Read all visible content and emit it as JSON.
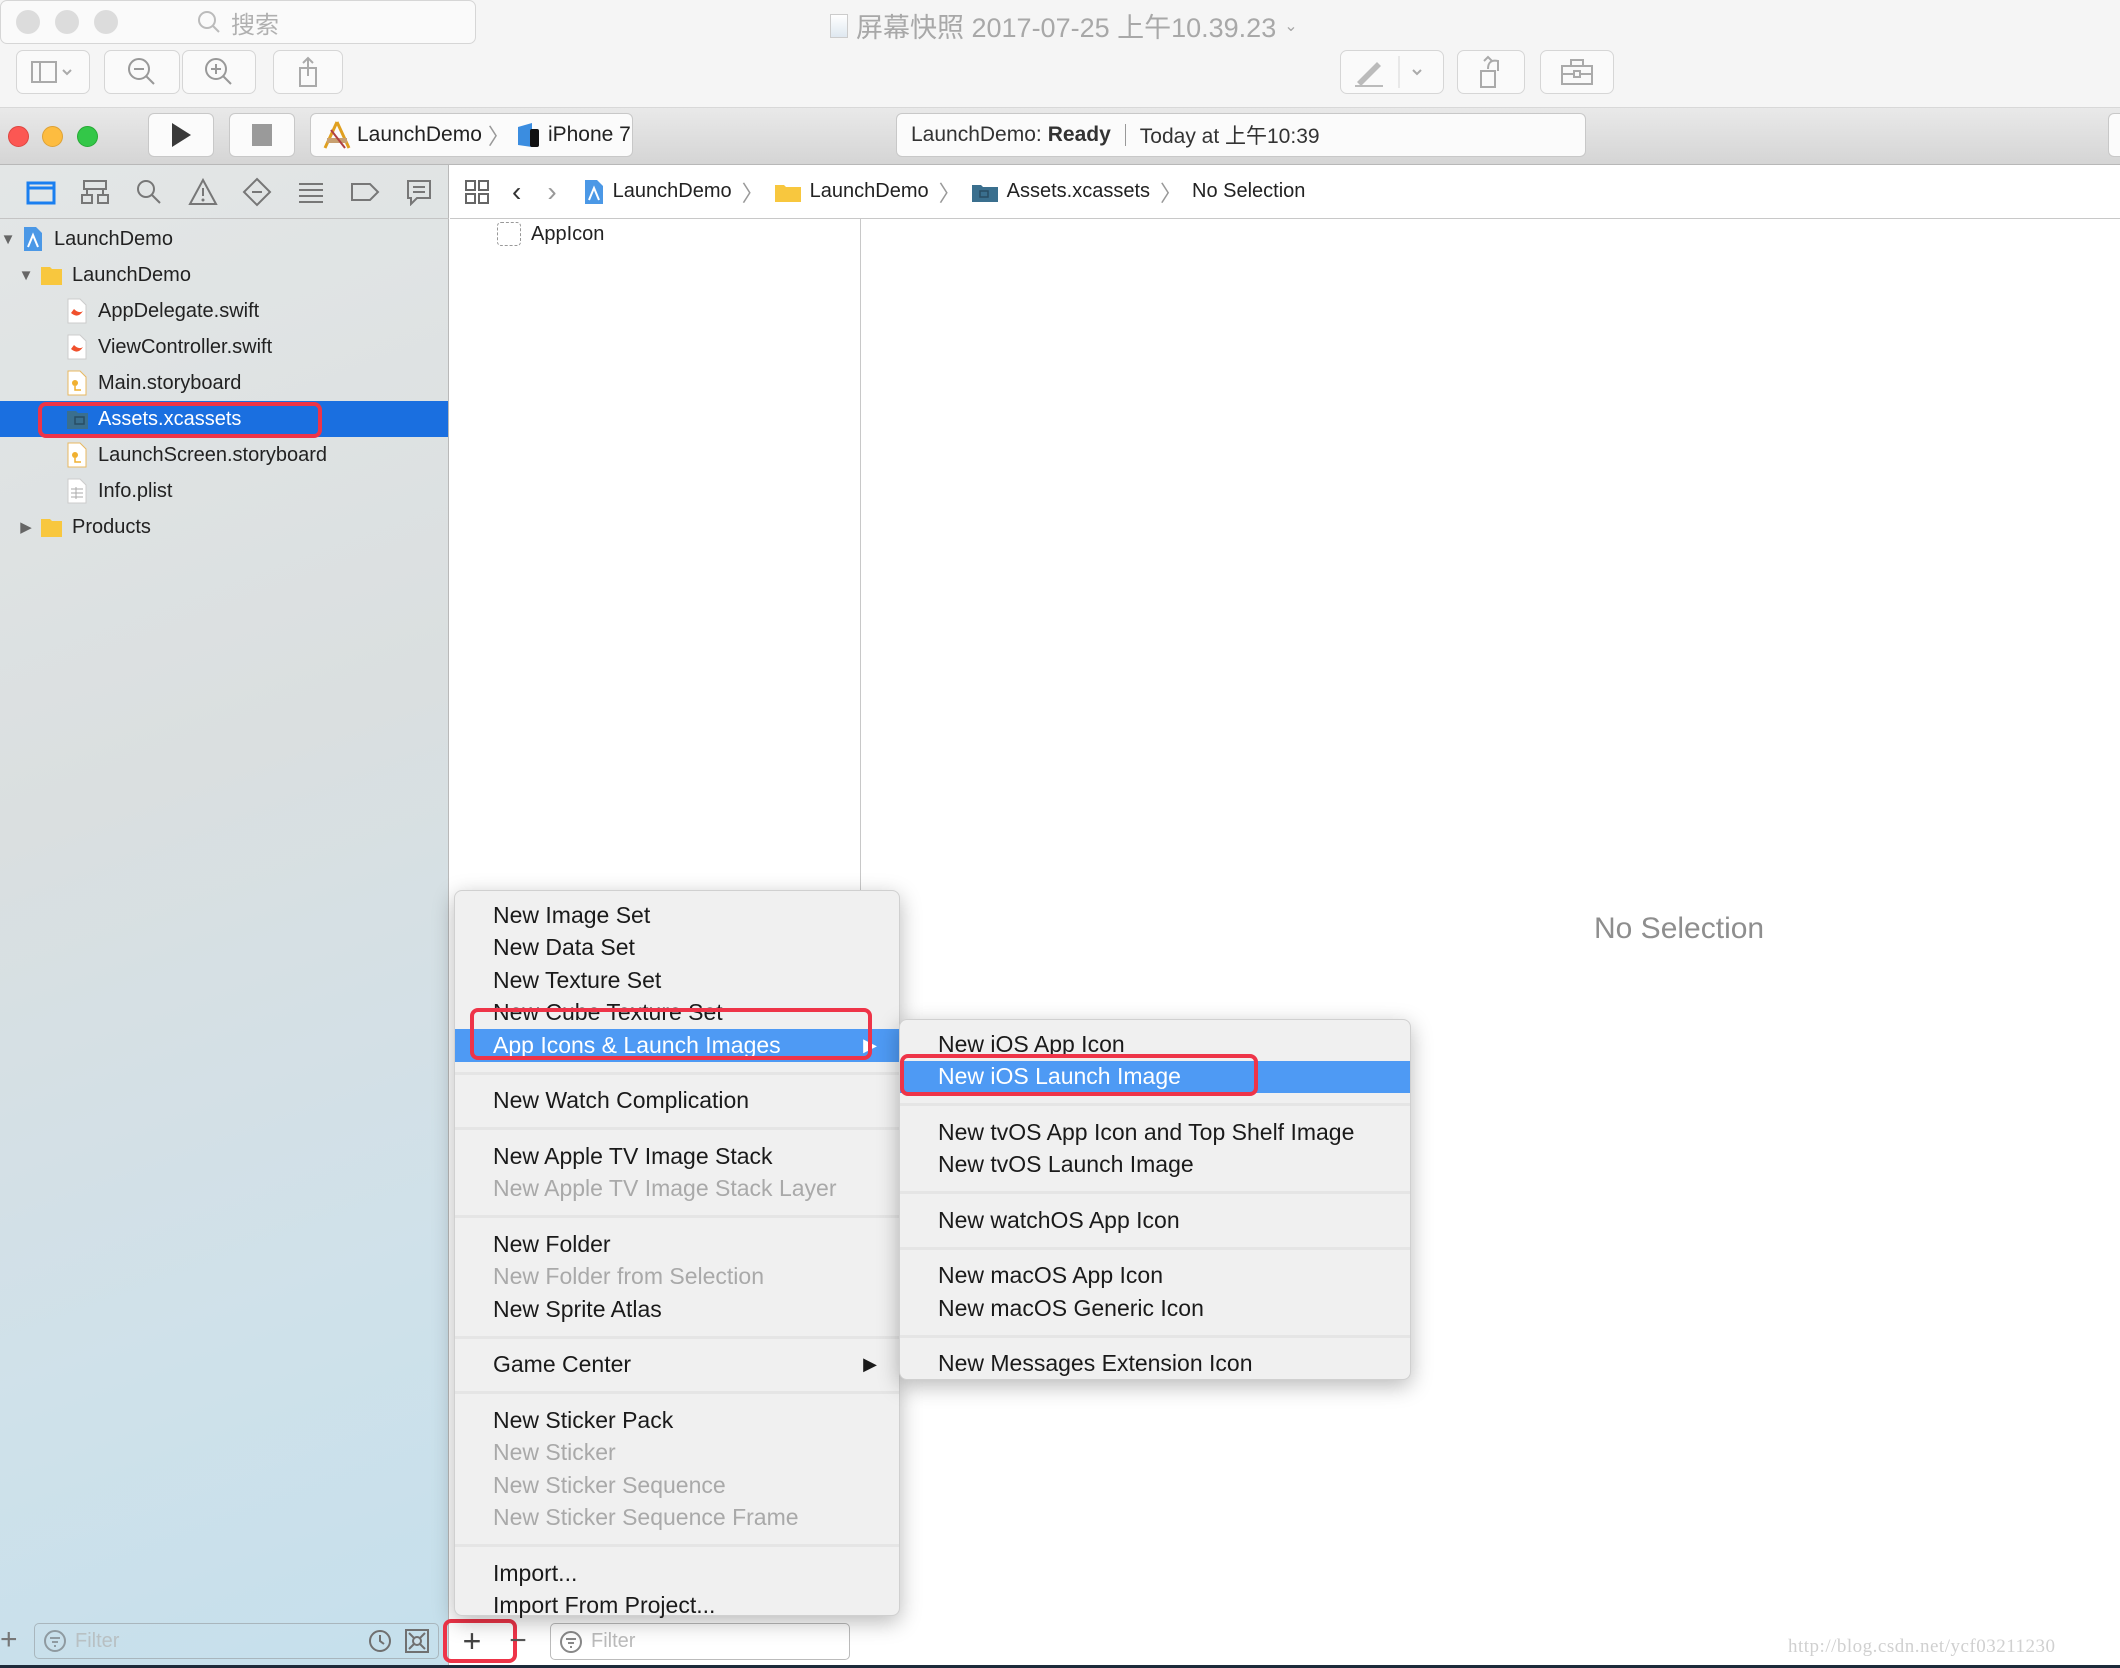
{
  "preview": {
    "title": "屏幕快照 2017-07-25 上午10.39.23",
    "search_placeholder": "搜索"
  },
  "toolbar": {
    "scheme_target": "LaunchDemo",
    "scheme_device": "iPhone 7",
    "activity_project": "LaunchDemo:",
    "activity_status": "Ready",
    "activity_time": "Today at 上午10:39"
  },
  "navigator": {
    "icons": [
      "folder-icon",
      "hierarchy-icon",
      "search-icon",
      "warning-icon",
      "test-diamond-icon",
      "debug-list-icon",
      "breakpoint-icon",
      "report-icon"
    ],
    "tree": [
      {
        "label": "LaunchDemo",
        "type": "project",
        "depth": 0,
        "expanded": true
      },
      {
        "label": "LaunchDemo",
        "type": "folder",
        "depth": 1,
        "expanded": true
      },
      {
        "label": "AppDelegate.swift",
        "type": "swift",
        "depth": 2
      },
      {
        "label": "ViewController.swift",
        "type": "swift",
        "depth": 2
      },
      {
        "label": "Main.storyboard",
        "type": "storyboard",
        "depth": 2
      },
      {
        "label": "Assets.xcassets",
        "type": "xcassets",
        "depth": 2,
        "selected": true
      },
      {
        "label": "LaunchScreen.storyboard",
        "type": "storyboard",
        "depth": 2
      },
      {
        "label": "Info.plist",
        "type": "plist",
        "depth": 2
      },
      {
        "label": "Products",
        "type": "folder",
        "depth": 1,
        "expanded": false
      }
    ],
    "filter_placeholder": "Filter"
  },
  "breadcrumb": {
    "items": [
      "LaunchDemo",
      "LaunchDemo",
      "Assets.xcassets",
      "No Selection"
    ]
  },
  "asset_list": {
    "items": [
      "AppIcon"
    ],
    "filter_placeholder": "Filter",
    "add_label": "+",
    "remove_label": "−"
  },
  "editor": {
    "empty_label": "No Selection"
  },
  "context_menu": {
    "groups": [
      [
        {
          "label": "New Image Set"
        },
        {
          "label": "New Data Set"
        },
        {
          "label": "New Texture Set"
        },
        {
          "label": "New Cube Texture Set"
        },
        {
          "label": "App Icons & Launch Images",
          "submenu": true,
          "highlighted": true
        }
      ],
      [
        {
          "label": "New Watch Complication"
        }
      ],
      [
        {
          "label": "New Apple TV Image Stack"
        },
        {
          "label": "New Apple TV Image Stack Layer",
          "disabled": true
        }
      ],
      [
        {
          "label": "New Folder"
        },
        {
          "label": "New Folder from Selection",
          "disabled": true
        },
        {
          "label": "New Sprite Atlas"
        }
      ],
      [
        {
          "label": "Game Center",
          "submenu": true
        }
      ],
      [
        {
          "label": "New Sticker Pack"
        },
        {
          "label": "New Sticker",
          "disabled": true
        },
        {
          "label": "New Sticker Sequence",
          "disabled": true
        },
        {
          "label": "New Sticker Sequence Frame",
          "disabled": true
        }
      ],
      [
        {
          "label": "Import..."
        },
        {
          "label": "Import From Project..."
        }
      ]
    ]
  },
  "submenu": {
    "groups": [
      [
        {
          "label": "New iOS App Icon"
        },
        {
          "label": "New iOS Launch Image",
          "highlighted": true
        }
      ],
      [
        {
          "label": "New tvOS App Icon and Top Shelf Image"
        },
        {
          "label": "New tvOS Launch Image"
        }
      ],
      [
        {
          "label": "New watchOS App Icon"
        }
      ],
      [
        {
          "label": "New macOS App Icon"
        },
        {
          "label": "New macOS Generic Icon"
        }
      ],
      [
        {
          "label": "New Messages Extension Icon"
        }
      ]
    ]
  },
  "watermark": "http://blog.csdn.net/ycf03211230",
  "colors": {
    "selection_blue": "#1a6fe0",
    "menu_highlight": "#4e9af4",
    "annotation_red": "#ee3448"
  }
}
